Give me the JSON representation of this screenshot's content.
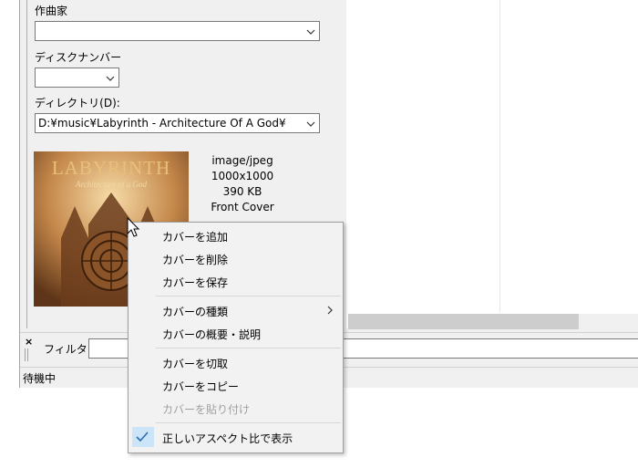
{
  "fields": {
    "composer_label": "作曲家",
    "composer_value": "",
    "disc_label": "ディスクナンバー",
    "disc_value": "",
    "directory_label": "ディレクトリ(D):",
    "directory_value": "D:¥music¥Labyrinth - Architecture Of A God¥"
  },
  "cover": {
    "album_title": "LABYRINTH",
    "album_subtitle": "Architecture of a God",
    "format": "image/jpeg",
    "dimensions": "1000x1000",
    "size": "390 KB",
    "type": "Front Cover"
  },
  "context_menu": {
    "items": [
      {
        "label": "カバーを追加",
        "enabled": true
      },
      {
        "label": "カバーを削除",
        "enabled": true
      },
      {
        "label": "カバーを保存",
        "enabled": true
      },
      {
        "label": "カバーの種類",
        "enabled": true,
        "submenu": true
      },
      {
        "label": "カバーの概要・説明",
        "enabled": true
      },
      {
        "label": "カバーを切取",
        "enabled": true
      },
      {
        "label": "カバーをコピー",
        "enabled": true
      },
      {
        "label": "カバーを貼り付け",
        "enabled": false
      },
      {
        "label": "正しいアスペクト比で表示",
        "enabled": true,
        "checked": true
      }
    ]
  },
  "filter": {
    "label": "フィルタ:",
    "value": ""
  },
  "status": {
    "text": "待機中"
  },
  "colors": {
    "menu_check_highlight": "#cce4f7",
    "check_mark": "#2b6cb0"
  }
}
